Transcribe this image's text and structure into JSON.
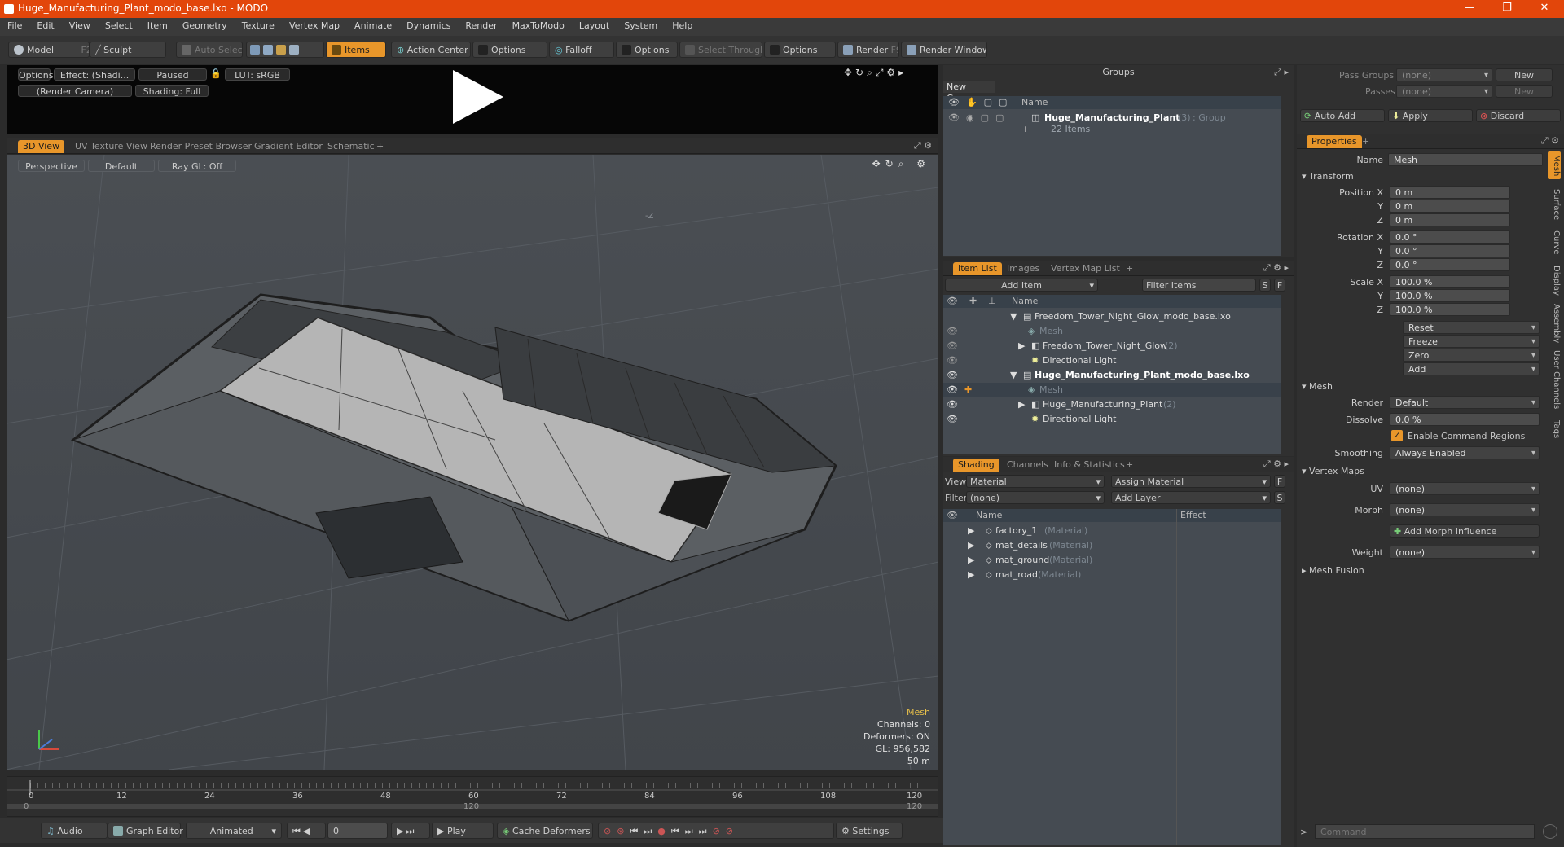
{
  "window": {
    "title": "Huge_Manufacturing_Plant_modo_base.lxo - MODO"
  },
  "menu": [
    "File",
    "Edit",
    "View",
    "Select",
    "Item",
    "Geometry",
    "Texture",
    "Vertex Map",
    "Animate",
    "Dynamics",
    "Render",
    "MaxToModo",
    "Layout",
    "System",
    "Help"
  ],
  "toolbar": {
    "model": "Model",
    "model_key": "F2",
    "sculpt": "Sculpt",
    "auto_select": "Auto Select",
    "items": "Items",
    "action_center": "Action Center",
    "options1": "Options",
    "falloff": "Falloff",
    "options2": "Options",
    "select_through": "Select Through",
    "options3": "Options",
    "render": "Render",
    "render_key": "F9",
    "render_window": "Render Window"
  },
  "preview": {
    "options": "Options",
    "effect": "Effect: (Shadi...",
    "paused": "Paused",
    "lut": "LUT: sRGB",
    "camera": "(Render Camera)",
    "shading": "Shading: Full"
  },
  "view_tabs": [
    "3D View",
    "UV Texture View",
    "Render Preset Browser",
    "Gradient Editor",
    "Schematic",
    "+"
  ],
  "viewport": {
    "mode": "Perspective",
    "style": "Default",
    "raygl": "Ray GL: Off",
    "axis": "-Z",
    "info_title": "Mesh",
    "channels": "Channels: 0",
    "deformers": "Deformers: ON",
    "gl": "GL: 956,582",
    "scale": "50 m"
  },
  "timeline": {
    "ticks": [
      "0",
      "12",
      "24",
      "36",
      "48",
      "60",
      "72",
      "84",
      "96",
      "108",
      "120"
    ],
    "start": "0",
    "mid": "120",
    "end": "120"
  },
  "bottom": {
    "audio": "Audio",
    "graph_editor": "Graph Editor",
    "animated": "Animated",
    "frame": "0",
    "play": "Play",
    "cache": "Cache Deformers",
    "settings": "Settings"
  },
  "groups": {
    "title": "Groups",
    "new_group": "New Group",
    "col_name": "Name",
    "group_name": "Huge_Manufacturing_Plant",
    "group_count": "(3)",
    "group_type": ": Group",
    "group_items": "22 Items"
  },
  "item_list": {
    "tabs": [
      "Item List",
      "Images",
      "Vertex Map List",
      "+"
    ],
    "add_item": "Add Item",
    "filter": "Filter Items",
    "col_name": "Name",
    "rows": [
      {
        "name": "Freedom_Tower_Night_Glow_modo_base.lxo",
        "level": 0,
        "bold": false
      },
      {
        "name": "Mesh",
        "level": 1,
        "bold": false,
        "dim": true
      },
      {
        "name": "Freedom_Tower_Night_Glow",
        "suffix": "(2)",
        "level": 1,
        "bold": false
      },
      {
        "name": "Directional Light",
        "level": 1,
        "bold": false
      },
      {
        "name": "Huge_Manufacturing_Plant_modo_base.lxo",
        "level": 0,
        "bold": true
      },
      {
        "name": "Mesh",
        "level": 1,
        "bold": false,
        "dim": true,
        "selected": true
      },
      {
        "name": "Huge_Manufacturing_Plant",
        "suffix": "(2)",
        "level": 1,
        "bold": false
      },
      {
        "name": "Directional Light",
        "level": 1,
        "bold": false
      }
    ]
  },
  "shading": {
    "tabs": [
      "Shading",
      "Channels",
      "Info & Statistics",
      "+"
    ],
    "view_label": "View",
    "view_value": "Material",
    "assign": "Assign Material",
    "filter_label": "Filter",
    "filter_value": "(none)",
    "add_layer": "Add Layer",
    "col_name": "Name",
    "col_effect": "Effect",
    "rows": [
      {
        "name": "factory_1",
        "type": "(Material)"
      },
      {
        "name": "mat_details",
        "type": "(Material)"
      },
      {
        "name": "mat_ground",
        "type": "(Material)"
      },
      {
        "name": "mat_road",
        "type": "(Material)"
      }
    ]
  },
  "props": {
    "pass_groups": "Pass Groups",
    "pass_groups_val": "(none)",
    "new": "New",
    "passes": "Passes",
    "passes_val": "(none)",
    "new2": "New",
    "auto_add": "Auto Add",
    "apply": "Apply",
    "discard": "Discard",
    "tab": "Properties",
    "plus": "+",
    "name_label": "Name",
    "name_val": "Mesh",
    "transform": "Transform",
    "pos_x_label": "Position X",
    "pos_x": "0 m",
    "y_label": "Y",
    "pos_y": "0 m",
    "z_label": "Z",
    "pos_z": "0 m",
    "rot_x_label": "Rotation X",
    "rot_x": "0.0 °",
    "rot_y": "0.0 °",
    "rot_z": "0.0 °",
    "scale_x_label": "Scale X",
    "scale_x": "100.0 %",
    "scale_y": "100.0 %",
    "scale_z": "100.0 %",
    "reset": "Reset",
    "freeze": "Freeze",
    "zero": "Zero",
    "add": "Add",
    "mesh_section": "Mesh",
    "render_label": "Render",
    "render_val": "Default",
    "dissolve_label": "Dissolve",
    "dissolve_val": "0.0 %",
    "enable_regions": "Enable Command Regions",
    "smoothing_label": "Smoothing",
    "smoothing_val": "Always Enabled",
    "vmaps": "Vertex Maps",
    "uv_label": "UV",
    "uv_val": "(none)",
    "morph_label": "Morph",
    "morph_val": "(none)",
    "add_morph": "Add Morph Influence",
    "weight_label": "Weight",
    "weight_val": "(none)",
    "mesh_fusion": "Mesh Fusion",
    "side_tabs": [
      "Mesh",
      "Surface",
      "Curve",
      "Display",
      "Assembly",
      "User Channels",
      "Tags"
    ],
    "command_placeholder": "Command"
  }
}
